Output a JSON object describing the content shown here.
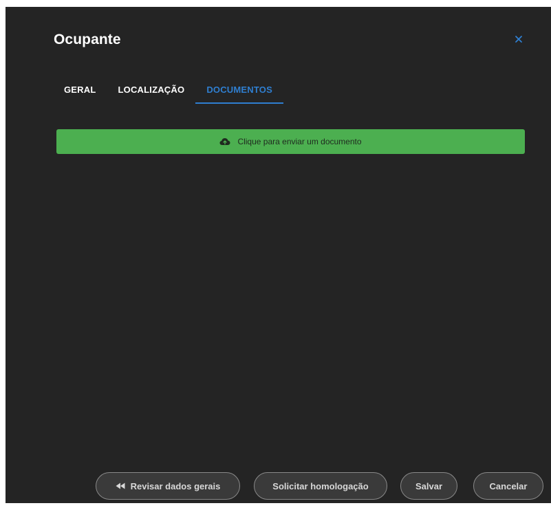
{
  "dialog": {
    "title": "Ocupante",
    "close_icon": "close-icon",
    "accent_color": "#2f7fd1"
  },
  "tabs": [
    {
      "label": "GERAL",
      "active": false
    },
    {
      "label": "LOCALIZAÇÃO",
      "active": false
    },
    {
      "label": "DOCUMENTOS",
      "active": true
    }
  ],
  "upload": {
    "label": "Clique para enviar um documento",
    "icon": "cloud-upload-icon",
    "color": "#4caf50"
  },
  "footer": {
    "review_label": "Revisar dados gerais",
    "review_icon": "rewind-icon",
    "homolog_label": "Solicitar homologação",
    "save_label": "Salvar",
    "cancel_label": "Cancelar"
  }
}
